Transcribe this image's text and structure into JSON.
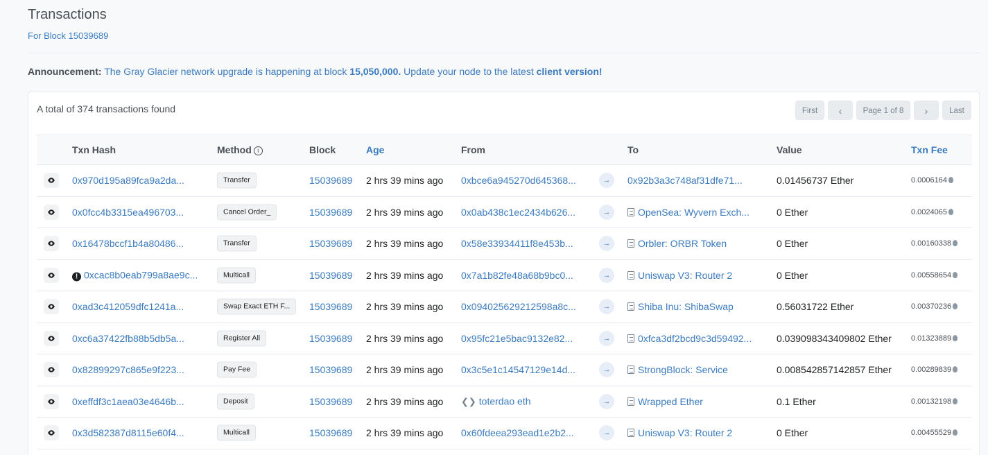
{
  "header": {
    "title": "Transactions",
    "subtitle": "For Block 15039689"
  },
  "announcement": {
    "label": "Announcement:",
    "text_before": "The Gray Glacier network upgrade is happening at block",
    "block": "15,050,000.",
    "text_after": "Update your node to the latest",
    "link": "client version!"
  },
  "summary": {
    "total_text": "A total of 374 transactions found"
  },
  "pagination": {
    "first": "First",
    "prev": "‹",
    "page": "Page 1 of 8",
    "next": "›",
    "last": "Last"
  },
  "columns": {
    "hash": "Txn Hash",
    "method": "Method",
    "block": "Block",
    "age": "Age",
    "from": "From",
    "to": "To",
    "value": "Value",
    "fee": "Txn Fee"
  },
  "rows": [
    {
      "hash": "0x970d195a89fca9a2da...",
      "method": "Transfer",
      "block": "15039689",
      "age": "2 hrs 39 mins ago",
      "from": "0xbce6a945270d645368...",
      "to": "0x92b3a3c748af31dfe71...",
      "value": "0.01456737 Ether",
      "fee": "0.0006164"
    },
    {
      "hash": "0x0fcc4b3315ea496703...",
      "method": "Cancel Order_",
      "block": "15039689",
      "age": "2 hrs 39 mins ago",
      "from": "0x0ab438c1ec2434b626...",
      "to": "OpenSea: Wyvern Exch...",
      "value": "0 Ether",
      "fee": "0.0024065"
    },
    {
      "hash": "0x16478bccf1b4a80486...",
      "method": "Transfer",
      "block": "15039689",
      "age": "2 hrs 39 mins ago",
      "from": "0x58e33934411f8e453b...",
      "to": "Orbler: ORBR Token",
      "value": "0 Ether",
      "fee": "0.00160338"
    },
    {
      "hash": "0xcac8b0eab799a8ae9c...",
      "method": "Multicall",
      "block": "15039689",
      "age": "2 hrs 39 mins ago",
      "from": "0x7a1b82fe48a68b9bc0...",
      "to": "Uniswap V3: Router 2",
      "value": "0 Ether",
      "fee": "0.00558654"
    },
    {
      "hash": "0xad3c412059dfc1241a...",
      "method": "Swap Exact ETH F...",
      "block": "15039689",
      "age": "2 hrs 39 mins ago",
      "from": "0x094025629212598a8c...",
      "to": "Shiba Inu: ShibaSwap",
      "value": "0.56031722 Ether",
      "fee": "0.00370236"
    },
    {
      "hash": "0xc6a37422fb88b5db5a...",
      "method": "Register All",
      "block": "15039689",
      "age": "2 hrs 39 mins ago",
      "from": "0x95fc21e5bac9132e82...",
      "to": "0xfca3df2bcd9c3d59492...",
      "value": "0.039098343409802 Ether",
      "fee": "0.01323889"
    },
    {
      "hash": "0x82899297c865e9f223...",
      "method": "Pay Fee",
      "block": "15039689",
      "age": "2 hrs 39 mins ago",
      "from": "0x3c5e1c14547129e14d...",
      "to": "StrongBlock: Service",
      "value": "0.008542857142857 Ether",
      "fee": "0.00289839"
    },
    {
      "hash": "0xeffdf3c1aea03e4646b...",
      "method": "Deposit",
      "block": "15039689",
      "age": "2 hrs 39 mins ago",
      "from": "toterdao eth",
      "to": "Wrapped Ether",
      "value": "0.1 Ether",
      "fee": "0.00132198"
    },
    {
      "hash": "0x3d582387d8115e60f4...",
      "method": "Multicall",
      "block": "15039689",
      "age": "2 hrs 39 mins ago",
      "from": "0x60fdeea293ead1e2b2...",
      "to": "Uniswap V3: Router 2",
      "value": "0 Ether",
      "fee": "0.00455529"
    }
  ],
  "icons": {
    "eye": "eye-icon",
    "arrow": "arrow-right-icon",
    "contract": "document-icon",
    "warning": "exclamation-circle-icon",
    "ens": "ens-icon",
    "gas": "gas-drop-icon",
    "info": "info-circle-icon"
  },
  "colors": {
    "link": "#3a7bbf",
    "text": "#1e2022",
    "muted": "#77838f",
    "background": "#f8f9fa"
  }
}
